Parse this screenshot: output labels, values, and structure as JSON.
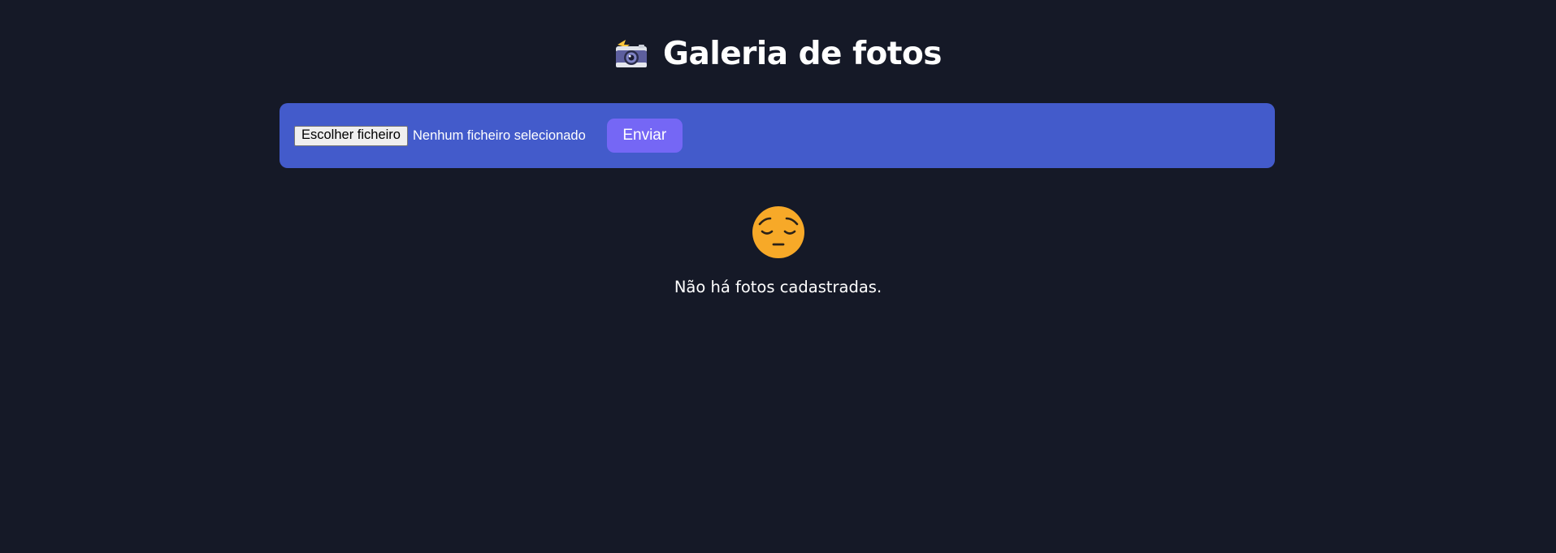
{
  "header": {
    "icon": "camera-with-flash-icon",
    "title": "Galeria de fotos"
  },
  "upload": {
    "choose_file_label": "Escolher ficheiro",
    "no_file_text": "Nenhum ficheiro selecionado",
    "submit_label": "Enviar"
  },
  "empty_state": {
    "icon": "pensive-face-icon",
    "message": "Não há fotos cadastradas."
  },
  "colors": {
    "background": "#151927",
    "panel": "#435bcb",
    "button": "#7567f5",
    "emoji": "#f7a928"
  }
}
